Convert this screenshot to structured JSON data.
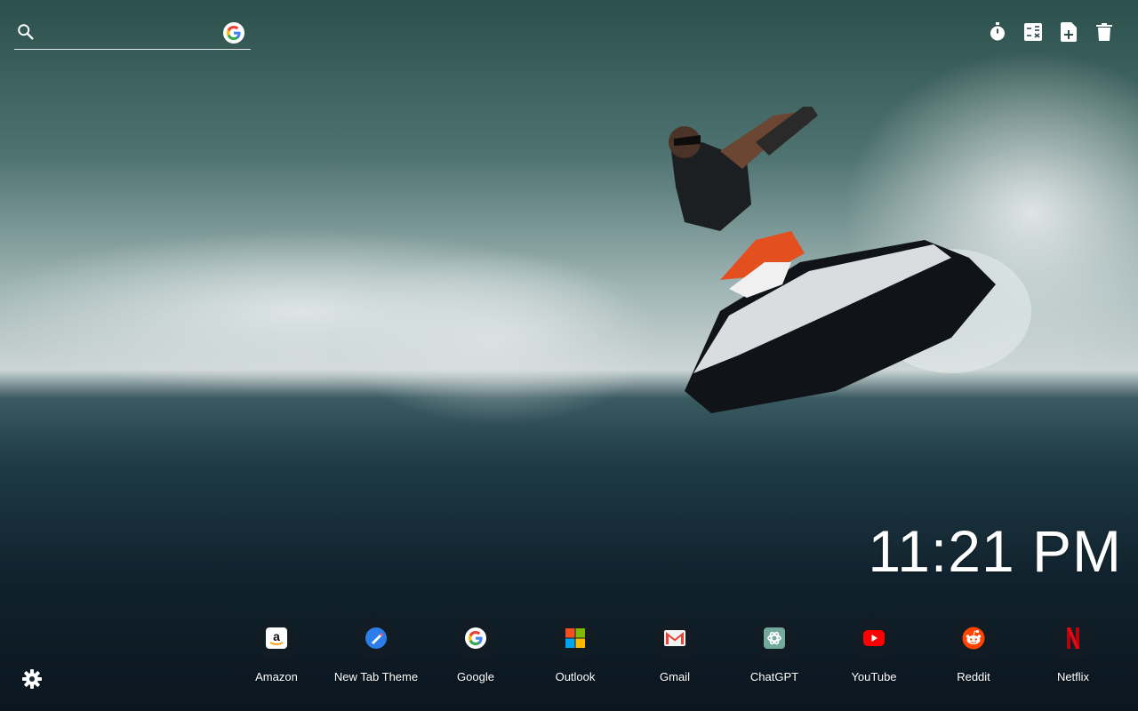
{
  "search": {
    "placeholder": "",
    "provider_icon": "google-g-icon"
  },
  "toolbar": {
    "icons": [
      "stopwatch-icon",
      "calculator-icon",
      "add-note-icon",
      "trash-icon"
    ]
  },
  "clock": {
    "time": "11:21 PM"
  },
  "shortcuts": [
    {
      "label": "Amazon",
      "icon": "amazon-icon"
    },
    {
      "label": "New Tab Theme",
      "icon": "new-tab-theme-icon"
    },
    {
      "label": "Google",
      "icon": "google-icon"
    },
    {
      "label": "Outlook",
      "icon": "outlook-icon"
    },
    {
      "label": "Gmail",
      "icon": "gmail-icon"
    },
    {
      "label": "ChatGPT",
      "icon": "chatgpt-icon"
    },
    {
      "label": "YouTube",
      "icon": "youtube-icon"
    },
    {
      "label": "Reddit",
      "icon": "reddit-icon"
    },
    {
      "label": "Netflix",
      "icon": "netflix-icon"
    }
  ],
  "settings": {
    "icon": "gear-icon"
  },
  "colors": {
    "google_blue": "#4285F4",
    "google_red": "#EA4335",
    "google_yellow": "#FBBC05",
    "google_green": "#34A853",
    "youtube_red": "#FF0000",
    "reddit_orange": "#FF4500",
    "netflix_red": "#E50914",
    "chatgpt_green": "#74AA9C"
  }
}
